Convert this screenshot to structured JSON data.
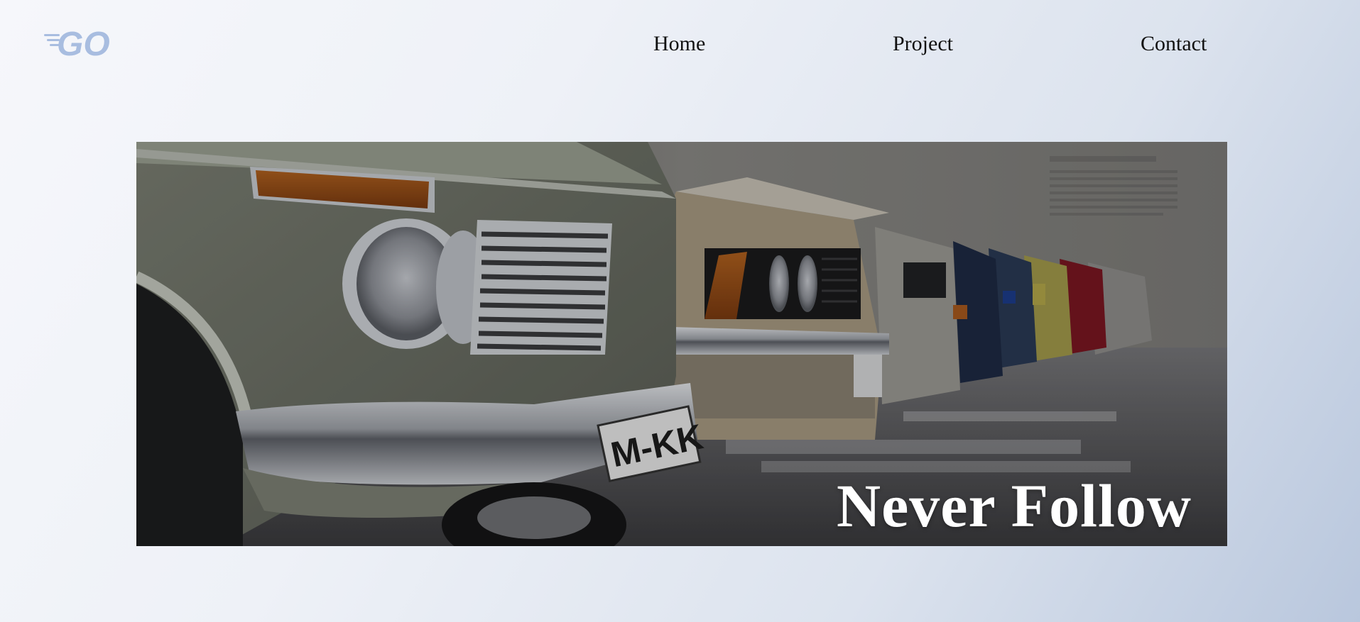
{
  "brand": {
    "logo_text": "GO",
    "logo_color": "#a8bde0"
  },
  "nav": {
    "items": [
      {
        "label": "Home"
      },
      {
        "label": "Project"
      },
      {
        "label": "Contact"
      }
    ]
  },
  "hero": {
    "title": "Never Follow",
    "image_alt": "",
    "plate_text": "M-KK"
  }
}
